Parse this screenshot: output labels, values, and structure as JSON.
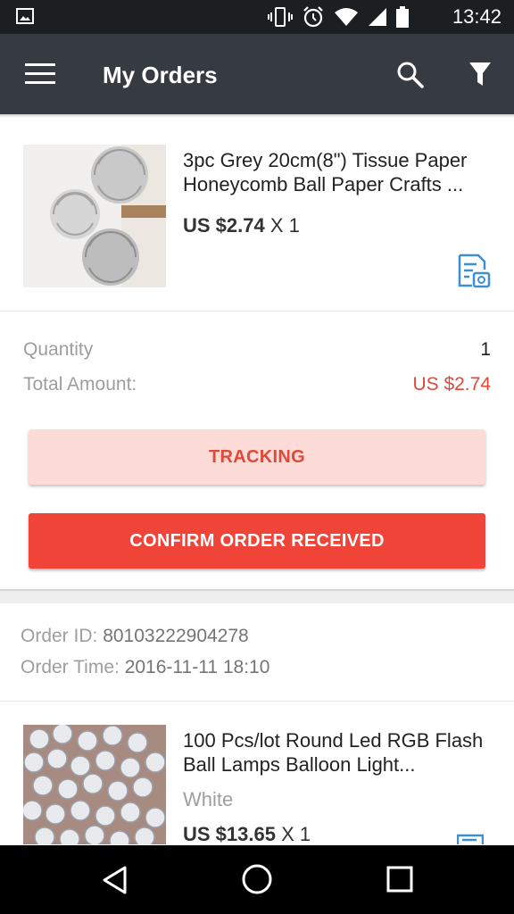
{
  "status_bar": {
    "time": "13:42",
    "icons": [
      "gallery-icon",
      "vibrate-icon",
      "alarm-icon",
      "wifi-icon",
      "signal-icon",
      "battery-icon"
    ]
  },
  "app_bar": {
    "title": "My Orders",
    "icons": [
      "menu-icon",
      "search-icon",
      "filter-icon"
    ]
  },
  "order1": {
    "product_title": "3pc Grey 20cm(8\") Tissue Paper Honeycomb Ball Paper Crafts ...",
    "price": "US $2.74",
    "quantity_suffix": "X 1",
    "quantity_label": "Quantity",
    "quantity_value": "1",
    "total_label": "Total Amount:",
    "total_value": "US $2.74",
    "tracking_label": "TRACKING",
    "confirm_label": "CONFIRM ORDER RECEIVED"
  },
  "order2": {
    "order_id_label": "Order ID:",
    "order_id": "80103222904278",
    "order_time_label": "Order Time:",
    "order_time": "2016-11-11 18:10",
    "product_title": "100 Pcs/lot Round Led RGB Flash Ball Lamps Balloon Light...",
    "variant": "White",
    "price": "US $13.65",
    "quantity_suffix": "X 1"
  },
  "colors": {
    "app_bar": "#353b40",
    "accent_red": "#f04438",
    "tracking_bg": "#fddbd7",
    "price_red": "#e0483a",
    "icon_blue": "#3d8fd1"
  }
}
